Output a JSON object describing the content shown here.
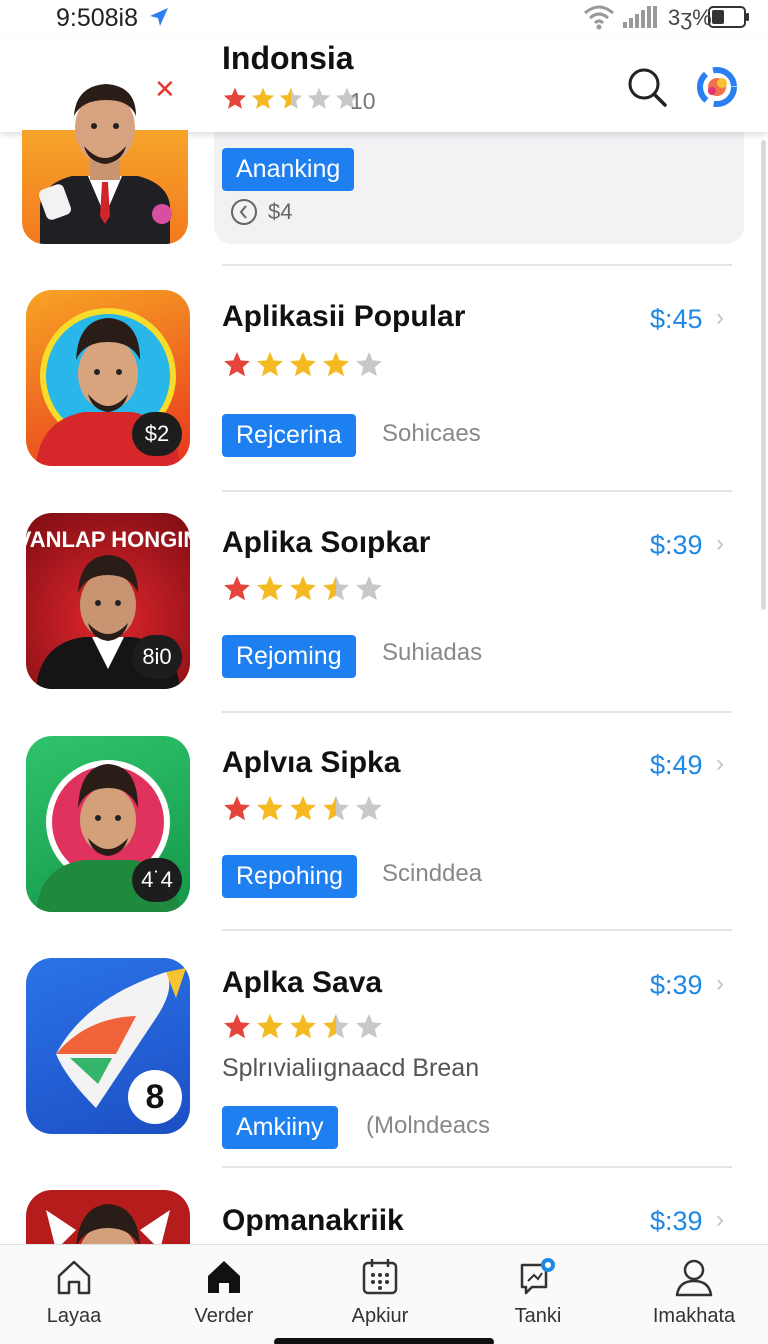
{
  "status_bar": {
    "time": "9:508i8",
    "battery": "3ʒ%"
  },
  "header": {
    "title": "Indonsia",
    "rating": 2.5,
    "rating_count": "10"
  },
  "first_item": {
    "badge": "Ananking",
    "price": "$4"
  },
  "apps": [
    {
      "name": "Aplikasii Popular",
      "price": "$:45",
      "rating": 4,
      "badge": "Rejcerina",
      "tag": "Sohicaes",
      "icon_badge": "$2",
      "icon_colors": [
        "#f7a524",
        "#e8361e"
      ]
    },
    {
      "name": "Aplika Soıpkar",
      "price": "$:39",
      "rating": 3.5,
      "badge": "Rejoming",
      "tag": "Suhiadas",
      "icon_badge": "8i0",
      "icon_text": "VANLAP HONGIN",
      "icon_colors": [
        "#d32027",
        "#7c0d12"
      ]
    },
    {
      "name": "Aplvıa Sipka",
      "price": "$:49",
      "rating": 3.5,
      "badge": "Repohing",
      "tag": "Scinddea",
      "icon_badge": "4˙4",
      "icon_colors": [
        "#2fc36b",
        "#14984a"
      ]
    },
    {
      "name": "Aplka Sava",
      "price": "$:39",
      "rating": 3.5,
      "description": "Splrıvialiıgnaacd Brean",
      "badge": "Amkiiny",
      "tag": "(Molndeacs",
      "icon_badge": "8",
      "icon_colors": [
        "#2b73e8",
        "#1c4fc4"
      ]
    },
    {
      "name": "Opmanakriik",
      "price": "$:39"
    }
  ],
  "tabs": [
    {
      "label": "Layaa",
      "icon": "home-outline-icon"
    },
    {
      "label": "Verder",
      "icon": "home-filled-icon"
    },
    {
      "label": "Apkiur",
      "icon": "calendar-icon"
    },
    {
      "label": "Tanki",
      "icon": "chat-badge-icon"
    },
    {
      "label": "Imakhata",
      "icon": "person-icon"
    }
  ],
  "colors": {
    "accent": "#1e7ff0",
    "price": "#1e88e5",
    "star_gold": "#f5b921",
    "star_red": "#e5443b",
    "star_empty": "#c8c8c8"
  }
}
